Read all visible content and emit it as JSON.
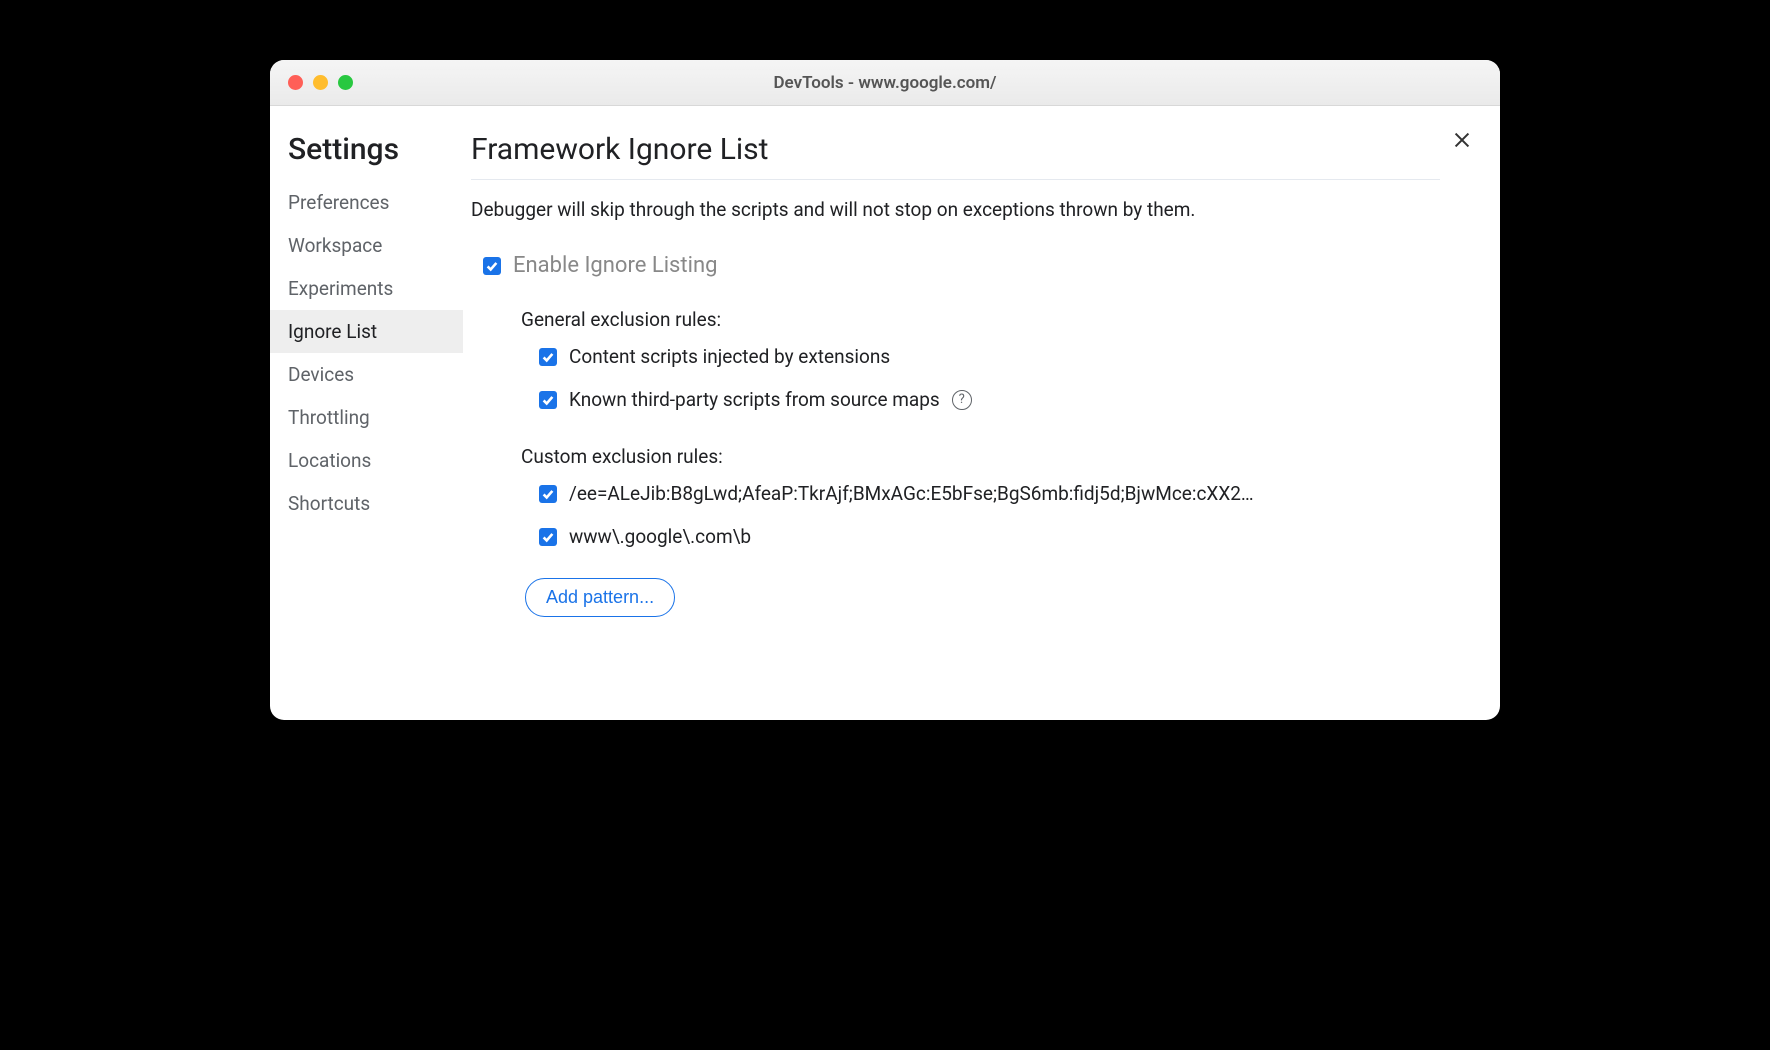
{
  "window": {
    "title": "DevTools - www.google.com/"
  },
  "sidebar": {
    "title": "Settings",
    "items": [
      {
        "label": "Preferences"
      },
      {
        "label": "Workspace"
      },
      {
        "label": "Experiments"
      },
      {
        "label": "Ignore List",
        "active": true
      },
      {
        "label": "Devices"
      },
      {
        "label": "Throttling"
      },
      {
        "label": "Locations"
      },
      {
        "label": "Shortcuts"
      }
    ]
  },
  "main": {
    "title": "Framework Ignore List",
    "description": "Debugger will skip through the scripts and will not stop on exceptions thrown by them.",
    "enable_label": "Enable Ignore Listing",
    "general_rules_label": "General exclusion rules:",
    "general_rules": [
      {
        "label": "Content scripts injected by extensions",
        "has_help": false
      },
      {
        "label": "Known third-party scripts from source maps",
        "has_help": true
      }
    ],
    "custom_rules_label": "Custom exclusion rules:",
    "custom_rules": [
      {
        "label": "/ee=ALeJib:B8gLwd;AfeaP:TkrAjf;BMxAGc:E5bFse;BgS6mb:fidj5d;BjwMce:cXX2…"
      },
      {
        "label": "www\\.google\\.com\\b"
      }
    ],
    "add_pattern_label": "Add pattern..."
  }
}
